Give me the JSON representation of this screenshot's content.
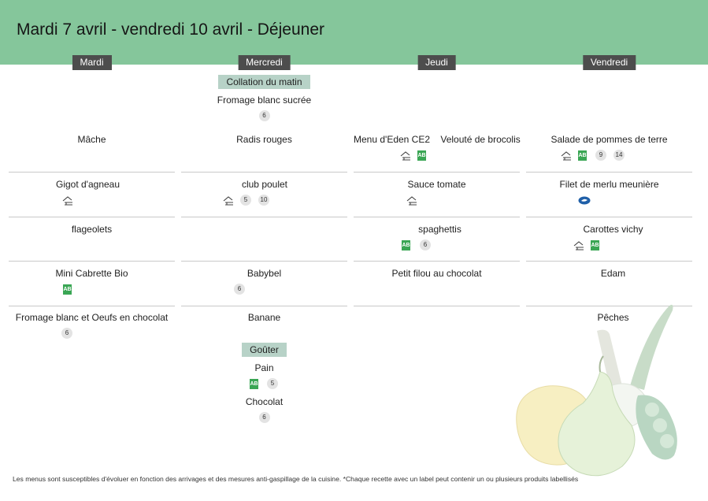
{
  "title": "Mardi 7 avril - vendredi 10 avril  - Déjeuner",
  "days": [
    "Mardi",
    "Mercredi",
    "Jeudi",
    "Vendredi"
  ],
  "collation": {
    "label": "Collation du matin",
    "item": "Fromage blanc sucrée",
    "badges": [
      "6"
    ]
  },
  "mardi": {
    "entree": "Mâche",
    "plat": "Gigot d'agneau",
    "accomp": "flageolets",
    "laitage": "Mini Cabrette Bio",
    "dessert": "Fromage blanc et Oeufs en chocolat",
    "dessert_badges": [
      "6"
    ]
  },
  "mercredi": {
    "entree": "Radis rouges",
    "plat": "club poulet",
    "plat_badges": [
      "5",
      "10"
    ],
    "laitage": "Babybel",
    "laitage_badges": [
      "6"
    ],
    "dessert": "Banane",
    "gouter_label": "Goûter",
    "gouter_items": [
      {
        "name": "Pain",
        "badges": [
          "5"
        ]
      },
      {
        "name": "Chocolat",
        "badges": [
          "6"
        ]
      }
    ]
  },
  "jeudi": {
    "entree": "Menu d'Eden CE2    Velouté de brocolis",
    "plat": "Sauce tomate",
    "accomp": "spaghettis",
    "accomp_badges": [
      "6"
    ],
    "laitage": "Petit filou au chocolat"
  },
  "vendredi": {
    "entree": "Salade de pommes de terre",
    "entree_badges": [
      "9",
      "14"
    ],
    "plat": "Filet de merlu meunière",
    "accomp": "Carottes vichy",
    "laitage": "Edam",
    "dessert": "Pêches"
  },
  "icons": {
    "homemade": "chef-hat-icon",
    "bio": "ab-organic-label-icon",
    "msc": "msc-fish-label-icon"
  },
  "colors": {
    "header": "#85c69b",
    "day_label": "#4d4d4d",
    "subsection": "#b7d2c7",
    "bio": "#3aa654",
    "msc": "#1f5fa8"
  },
  "footer": "Les menus sont susceptibles d'évoluer en fonction des arrivages et des mesures anti-gaspillage de la cuisine. *Chaque recette avec un label peut contenir un ou plusieurs produits labellisés"
}
